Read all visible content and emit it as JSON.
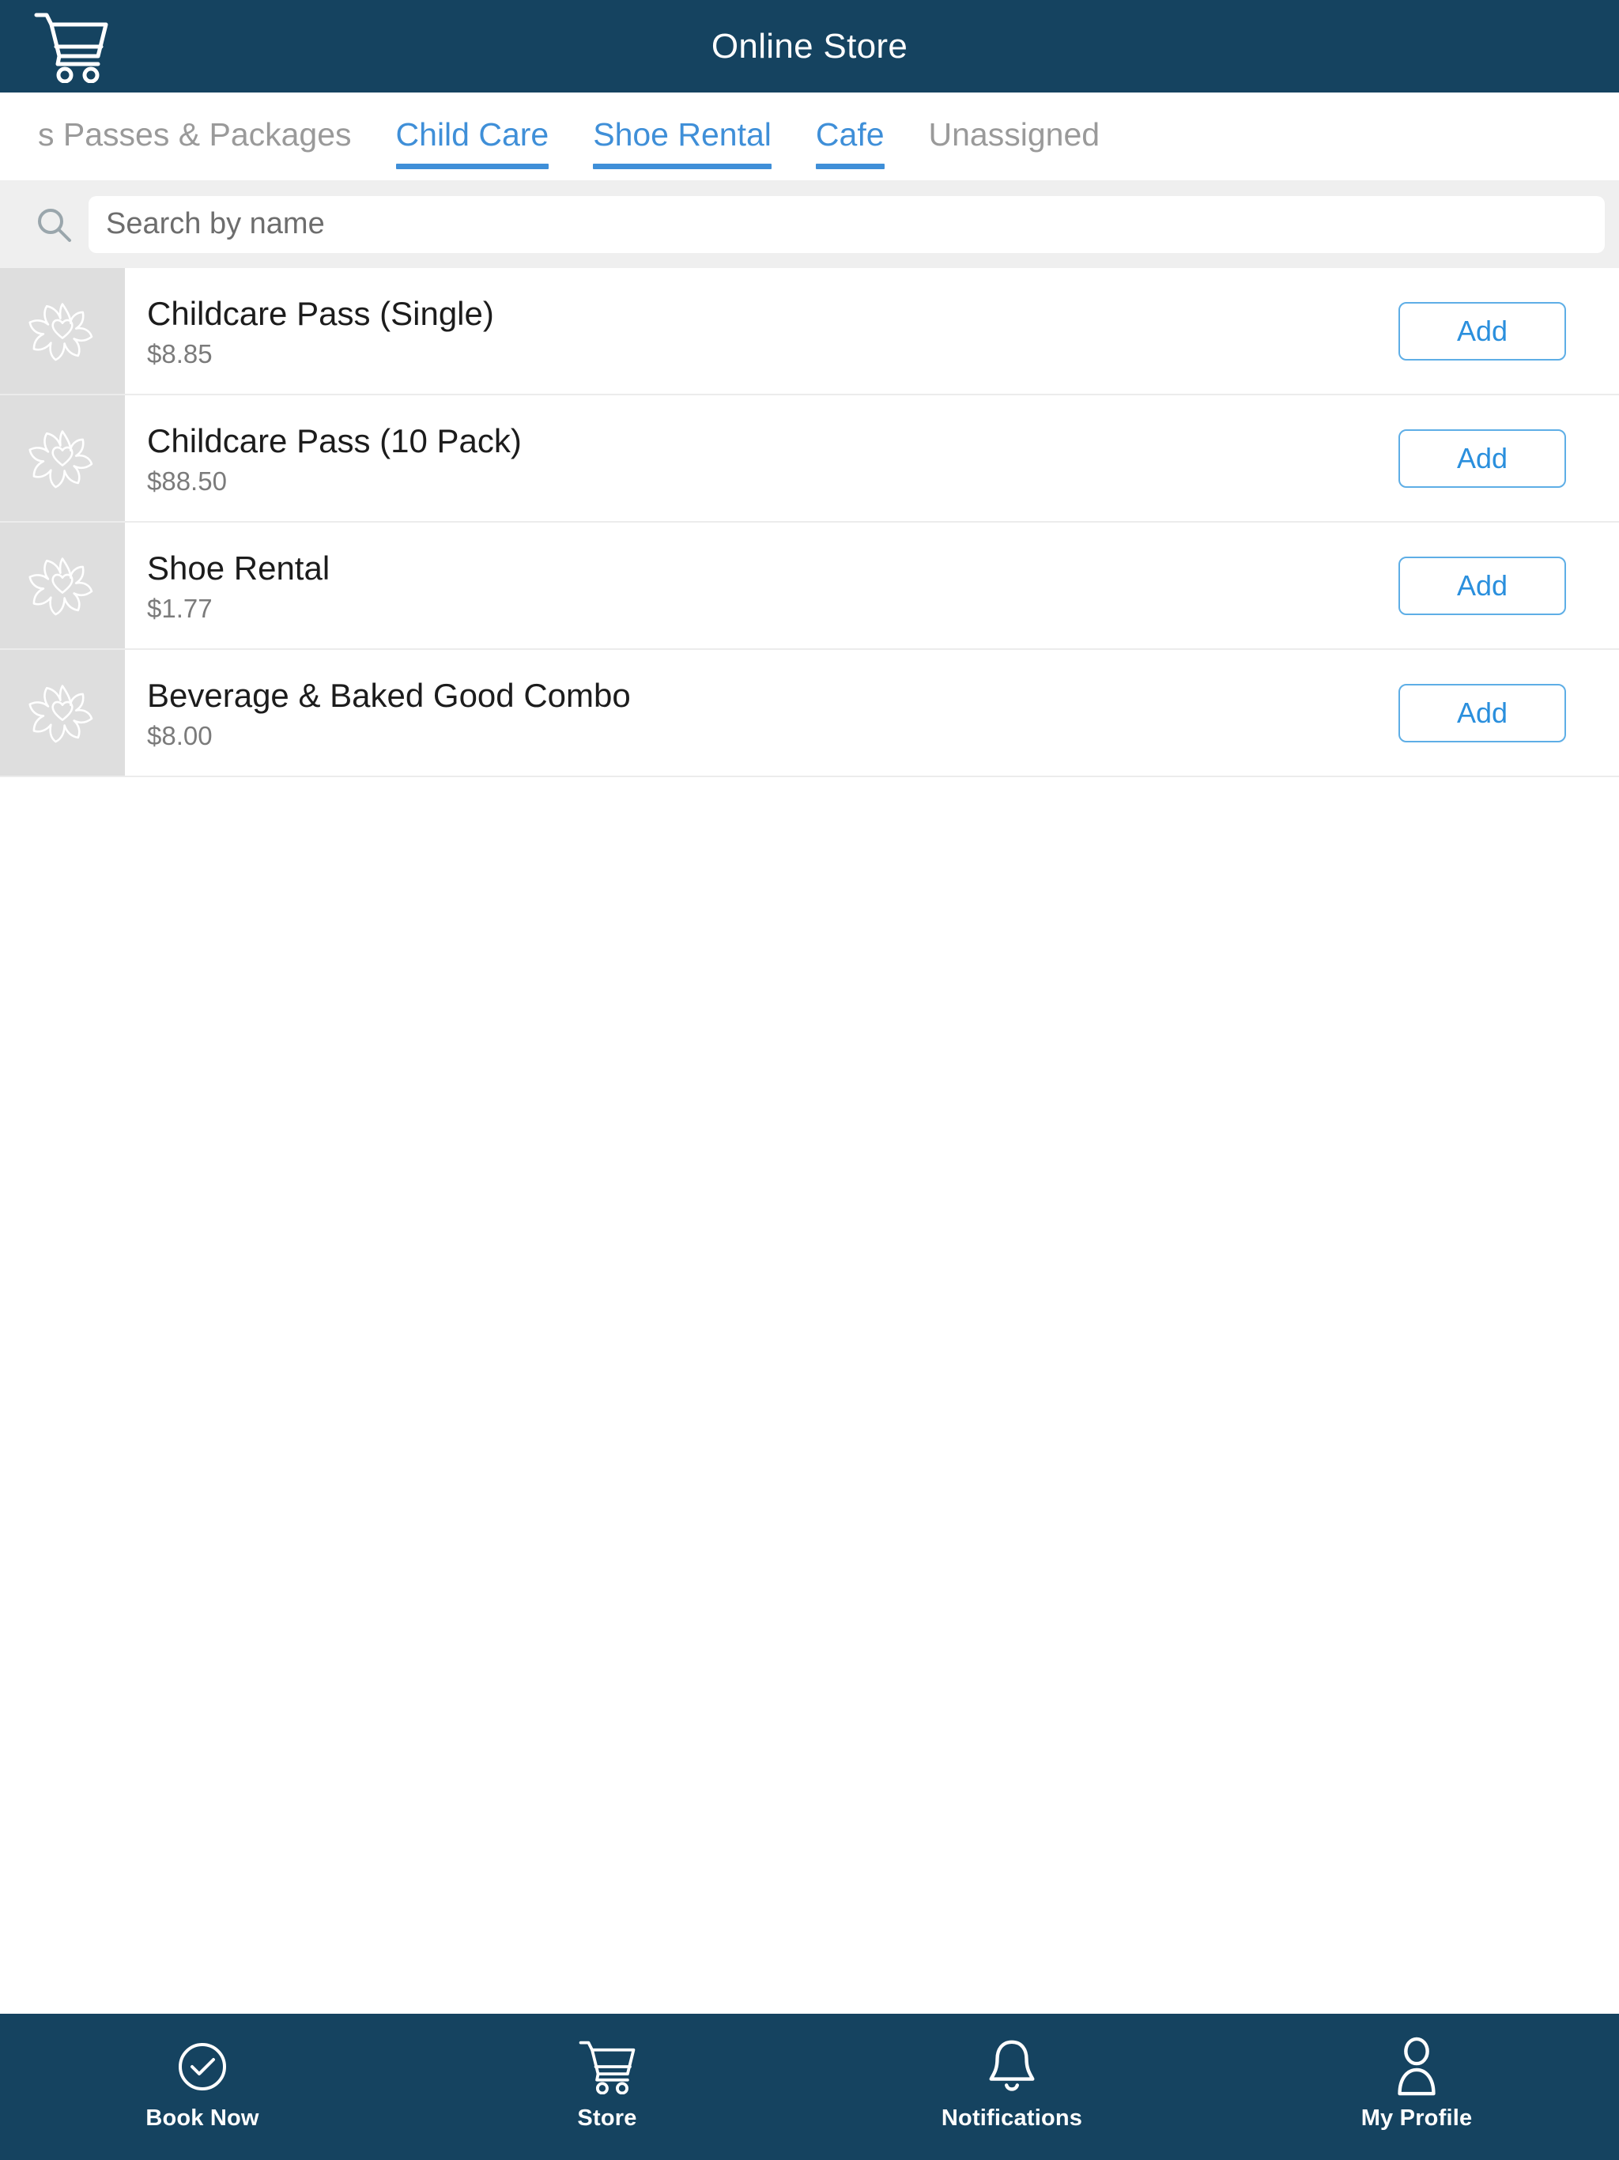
{
  "header": {
    "title": "Online Store",
    "cart_icon": "shopping-cart-icon"
  },
  "tabs": [
    {
      "label": "s Passes & Packages",
      "active": false,
      "truncated": true
    },
    {
      "label": "Child Care",
      "active": true
    },
    {
      "label": "Shoe Rental",
      "active": true
    },
    {
      "label": "Cafe",
      "active": true
    },
    {
      "label": "Unassigned",
      "active": false
    }
  ],
  "search": {
    "icon": "search-icon",
    "placeholder": "Search by name",
    "value": ""
  },
  "products": [
    {
      "name": "Childcare Pass (Single)",
      "price": "$8.85",
      "thumb_icon": "flower-placeholder-icon",
      "action_label": "Add"
    },
    {
      "name": "Childcare Pass (10 Pack)",
      "price": "$88.50",
      "thumb_icon": "flower-placeholder-icon",
      "action_label": "Add"
    },
    {
      "name": "Shoe Rental",
      "price": "$1.77",
      "thumb_icon": "flower-placeholder-icon",
      "action_label": "Add"
    },
    {
      "name": "Beverage & Baked Good Combo",
      "price": "$8.00",
      "thumb_icon": "flower-placeholder-icon",
      "action_label": "Add"
    }
  ],
  "bottom_nav": [
    {
      "label": "Book Now",
      "icon": "check-circle-icon"
    },
    {
      "label": "Store",
      "icon": "shopping-cart-icon"
    },
    {
      "label": "Notifications",
      "icon": "bell-icon"
    },
    {
      "label": "My Profile",
      "icon": "person-icon"
    }
  ],
  "colors": {
    "header_bg": "#154360",
    "accent_blue": "#3f8fd8",
    "add_button_blue": "#2a8fdd",
    "tab_inactive": "#9a9a9a",
    "search_bg": "#efefef",
    "thumb_bg": "#dedede",
    "row_divider": "#ececec",
    "price_text": "#7b7b7b",
    "title_text": "#1c1c1c"
  }
}
